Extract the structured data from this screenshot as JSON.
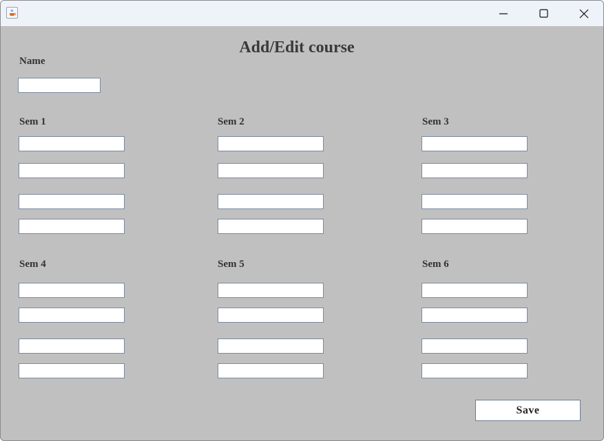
{
  "window": {
    "title": "",
    "icons": {
      "app": "java-cup-icon",
      "minimize": "minimize-icon",
      "maximize": "maximize-icon",
      "close": "close-icon"
    }
  },
  "form": {
    "heading": "Add/Edit course",
    "name_label": "Name",
    "name_value": "",
    "sem1": {
      "label": "Sem 1",
      "fields": [
        "",
        "",
        "",
        ""
      ]
    },
    "sem2": {
      "label": "Sem 2",
      "fields": [
        "",
        "",
        "",
        ""
      ]
    },
    "sem3": {
      "label": "Sem 3",
      "fields": [
        "",
        "",
        "",
        ""
      ]
    },
    "sem4": {
      "label": "Sem 4",
      "fields": [
        "",
        "",
        "",
        ""
      ]
    },
    "sem5": {
      "label": "Sem 5",
      "fields": [
        "",
        "",
        "",
        ""
      ]
    },
    "sem6": {
      "label": "Sem 6",
      "fields": [
        "",
        "",
        "",
        ""
      ]
    },
    "save_label": "Save"
  },
  "colors": {
    "background": "#c0c0c0",
    "titlebar": "#eef2f9",
    "field_border": "#7a8aa0"
  }
}
